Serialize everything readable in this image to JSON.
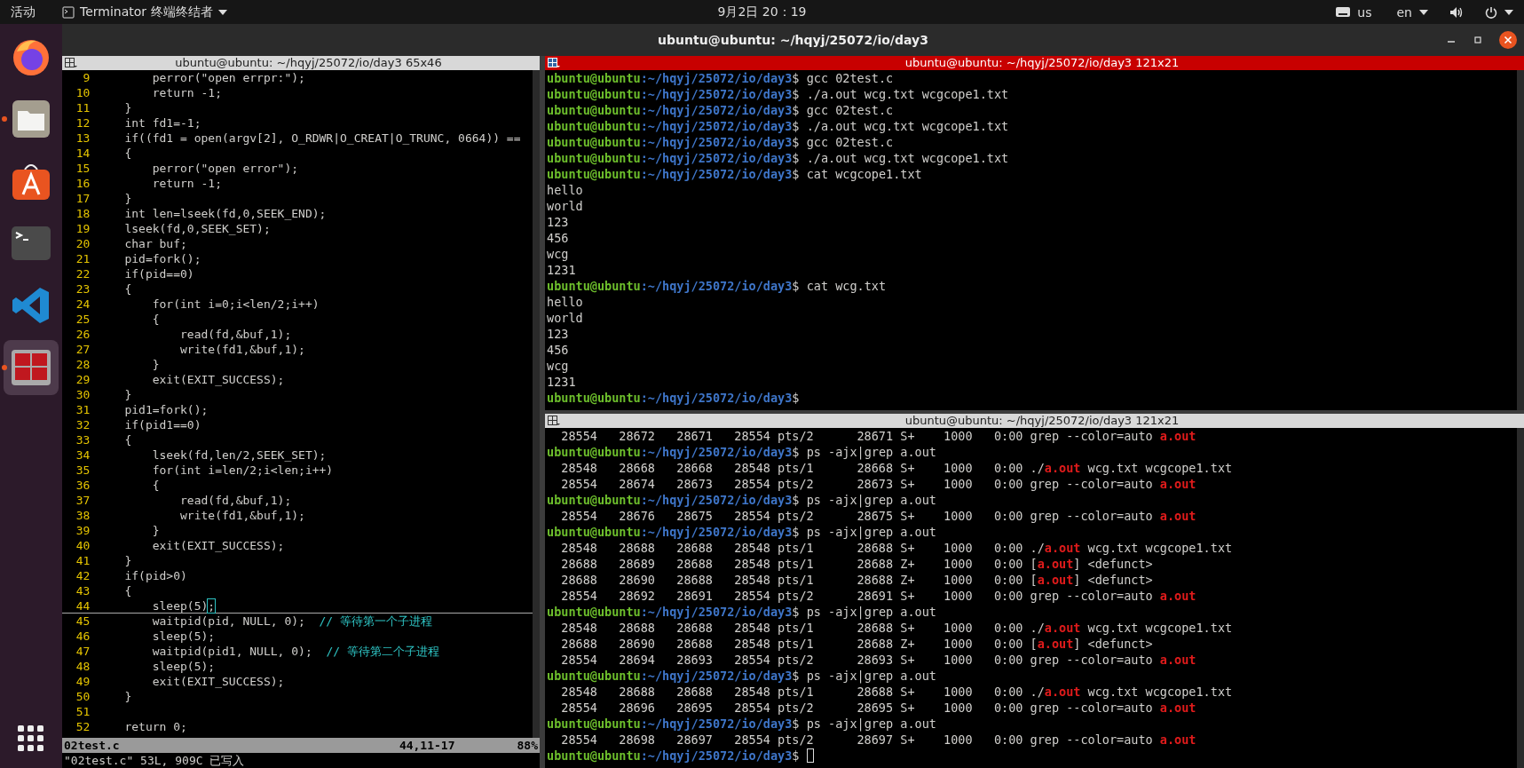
{
  "top_bar": {
    "activities": "活动",
    "app_menu": "Terminator 终端终结者",
    "clock": "9月2日 20：19",
    "keyboard": "us",
    "language": "en"
  },
  "dock": {
    "items": [
      {
        "kind": "firefox",
        "running": false,
        "selected": false
      },
      {
        "kind": "files",
        "running": true,
        "selected": false
      },
      {
        "kind": "store",
        "running": false,
        "selected": false
      },
      {
        "kind": "terminal",
        "running": false,
        "selected": false
      },
      {
        "kind": "vscode",
        "running": false,
        "selected": false
      },
      {
        "kind": "terminator",
        "running": true,
        "selected": true
      }
    ]
  },
  "window": {
    "title": "ubuntu@ubuntu: ~/hqyj/25072/io/day3"
  },
  "editor_pane": {
    "title": "ubuntu@ubuntu: ~/hqyj/25072/io/day3 65x46",
    "focused": false,
    "lines": [
      {
        "num": "9",
        "text": "        perror(\"open errpr:\");"
      },
      {
        "num": "10",
        "text": "        return -1;"
      },
      {
        "num": "11",
        "text": "    }"
      },
      {
        "num": "12",
        "text": "    int fd1=-1;"
      },
      {
        "num": "13",
        "text": "    if((fd1 = open(argv[2], O_RDWR|O_CREAT|O_TRUNC, 0664)) =="
      },
      {
        "num": "14",
        "text": "    {"
      },
      {
        "num": "15",
        "text": "        perror(\"open error\");"
      },
      {
        "num": "16",
        "text": "        return -1;"
      },
      {
        "num": "17",
        "text": "    }"
      },
      {
        "num": "18",
        "text": "    int len=lseek(fd,0,SEEK_END);"
      },
      {
        "num": "19",
        "text": "    lseek(fd,0,SEEK_SET);"
      },
      {
        "num": "20",
        "text": "    char buf;"
      },
      {
        "num": "21",
        "text": "    pid=fork();"
      },
      {
        "num": "22",
        "text": "    if(pid==0)"
      },
      {
        "num": "23",
        "text": "    {"
      },
      {
        "num": "24",
        "text": "        for(int i=0;i<len/2;i++)"
      },
      {
        "num": "25",
        "text": "        {"
      },
      {
        "num": "26",
        "text": "            read(fd,&buf,1);"
      },
      {
        "num": "27",
        "text": "            write(fd1,&buf,1);"
      },
      {
        "num": "28",
        "text": "        }"
      },
      {
        "num": "29",
        "text": "        exit(EXIT_SUCCESS);"
      },
      {
        "num": "30",
        "text": "    }"
      },
      {
        "num": "31",
        "text": "    pid1=fork();"
      },
      {
        "num": "32",
        "text": "    if(pid1==0)"
      },
      {
        "num": "33",
        "text": "    {"
      },
      {
        "num": "34",
        "text": "        lseek(fd,len/2,SEEK_SET);"
      },
      {
        "num": "35",
        "text": "        for(int i=len/2;i<len;i++)"
      },
      {
        "num": "36",
        "text": "        {"
      },
      {
        "num": "37",
        "text": "            read(fd,&buf,1);"
      },
      {
        "num": "38",
        "text": "            write(fd1,&buf,1);"
      },
      {
        "num": "39",
        "text": "        }"
      },
      {
        "num": "40",
        "text": "        exit(EXIT_SUCCESS);"
      },
      {
        "num": "41",
        "text": "    }"
      },
      {
        "num": "42",
        "text": "    if(pid>0)"
      },
      {
        "num": "43",
        "text": "    {"
      },
      {
        "num": "44",
        "text": "        sleep(5)",
        "cursor": ";",
        "current": true
      },
      {
        "num": "45",
        "text": "        waitpid(pid, NULL, 0);  ",
        "comment": "// 等待第一个子进程"
      },
      {
        "num": "46",
        "text": "        sleep(5);"
      },
      {
        "num": "47",
        "text": "        waitpid(pid1, NULL, 0);  ",
        "comment": "// 等待第二个子进程"
      },
      {
        "num": "48",
        "text": "        sleep(5);"
      },
      {
        "num": "49",
        "text": "        exit(EXIT_SUCCESS);"
      },
      {
        "num": "50",
        "text": "    }"
      },
      {
        "num": "51"
      },
      {
        "num": "52",
        "text": "    return 0;"
      }
    ],
    "status": {
      "file": "02test.c",
      "position": "44,11-17",
      "percent": "88%"
    },
    "message": "\"02test.c\" 53L, 909C 已写入"
  },
  "terminal_panes": [
    {
      "title": "ubuntu@ubuntu: ~/hqyj/25072/io/day3 121x21",
      "focused": true,
      "lines": [
        {
          "kind": "prompt",
          "user": "ubuntu@ubuntu",
          "path": ":~/hqyj/25072/io/day3",
          "sign": "$",
          "command": "gcc 02test.c"
        },
        {
          "kind": "prompt",
          "user": "ubuntu@ubuntu",
          "path": ":~/hqyj/25072/io/day3",
          "sign": "$",
          "command": "./a.out wcg.txt wcgcope1.txt"
        },
        {
          "kind": "prompt",
          "user": "ubuntu@ubuntu",
          "path": ":~/hqyj/25072/io/day3",
          "sign": "$",
          "command": "gcc 02test.c"
        },
        {
          "kind": "prompt",
          "user": "ubuntu@ubuntu",
          "path": ":~/hqyj/25072/io/day3",
          "sign": "$",
          "command": "./a.out wcg.txt wcgcope1.txt"
        },
        {
          "kind": "prompt",
          "user": "ubuntu@ubuntu",
          "path": ":~/hqyj/25072/io/day3",
          "sign": "$",
          "command": "gcc 02test.c"
        },
        {
          "kind": "prompt",
          "user": "ubuntu@ubuntu",
          "path": ":~/hqyj/25072/io/day3",
          "sign": "$",
          "command": "./a.out wcg.txt wcgcope1.txt"
        },
        {
          "kind": "prompt",
          "user": "ubuntu@ubuntu",
          "path": ":~/hqyj/25072/io/day3",
          "sign": "$",
          "command": "cat wcgcope1.txt"
        },
        {
          "kind": "output",
          "text": "hello"
        },
        {
          "kind": "output",
          "text": "world"
        },
        {
          "kind": "output",
          "text": "123"
        },
        {
          "kind": "output",
          "text": "456"
        },
        {
          "kind": "output",
          "text": "wcg"
        },
        {
          "kind": "output",
          "text": "1231"
        },
        {
          "kind": "prompt",
          "user": "ubuntu@ubuntu",
          "path": ":~/hqyj/25072/io/day3",
          "sign": "$",
          "command": "cat wcg.txt"
        },
        {
          "kind": "output",
          "text": "hello"
        },
        {
          "kind": "output",
          "text": "world"
        },
        {
          "kind": "output",
          "text": "123"
        },
        {
          "kind": "output",
          "text": "456"
        },
        {
          "kind": "output",
          "text": "wcg"
        },
        {
          "kind": "output",
          "text": "1231"
        },
        {
          "kind": "prompt",
          "user": "ubuntu@ubuntu",
          "path": ":~/hqyj/25072/io/day3",
          "sign": "$"
        }
      ]
    },
    {
      "title": "ubuntu@ubuntu: ~/hqyj/25072/io/day3 121x21",
      "focused": false,
      "lines": [
        {
          "kind": "match",
          "before": "  28554   28672   28671   28554 pts/2      28671 S+    1000   0:00 grep --color=auto ",
          "match": "a.out"
        },
        {
          "kind": "prompt",
          "user": "ubuntu@ubuntu",
          "path": ":~/hqyj/25072/io/day3",
          "sign": "$",
          "command": "ps -ajx|grep a.out"
        },
        {
          "kind": "match",
          "before": "  28548   28668   28668   28548 pts/1      28668 S+    1000   0:00 ./",
          "match": "a.out",
          "after": " wcg.txt wcgcope1.txt"
        },
        {
          "kind": "match",
          "before": "  28554   28674   28673   28554 pts/2      28673 S+    1000   0:00 grep --color=auto ",
          "match": "a.out"
        },
        {
          "kind": "prompt",
          "user": "ubuntu@ubuntu",
          "path": ":~/hqyj/25072/io/day3",
          "sign": "$",
          "command": "ps -ajx|grep a.out"
        },
        {
          "kind": "match",
          "before": "  28554   28676   28675   28554 pts/2      28675 S+    1000   0:00 grep --color=auto ",
          "match": "a.out"
        },
        {
          "kind": "prompt",
          "user": "ubuntu@ubuntu",
          "path": ":~/hqyj/25072/io/day3",
          "sign": "$",
          "command": "ps -ajx|grep a.out"
        },
        {
          "kind": "match",
          "before": "  28548   28688   28688   28548 pts/1      28688 S+    1000   0:00 ./",
          "match": "a.out",
          "after": " wcg.txt wcgcope1.txt"
        },
        {
          "kind": "match",
          "before": "  28688   28689   28688   28548 pts/1      28688 Z+    1000   0:00 [",
          "match": "a.out",
          "after": "] <defunct>"
        },
        {
          "kind": "match",
          "before": "  28688   28690   28688   28548 pts/1      28688 Z+    1000   0:00 [",
          "match": "a.out",
          "after": "] <defunct>"
        },
        {
          "kind": "match",
          "before": "  28554   28692   28691   28554 pts/2      28691 S+    1000   0:00 grep --color=auto ",
          "match": "a.out"
        },
        {
          "kind": "prompt",
          "user": "ubuntu@ubuntu",
          "path": ":~/hqyj/25072/io/day3",
          "sign": "$",
          "command": "ps -ajx|grep a.out"
        },
        {
          "kind": "match",
          "before": "  28548   28688   28688   28548 pts/1      28688 S+    1000   0:00 ./",
          "match": "a.out",
          "after": " wcg.txt wcgcope1.txt"
        },
        {
          "kind": "match",
          "before": "  28688   28690   28688   28548 pts/1      28688 Z+    1000   0:00 [",
          "match": "a.out",
          "after": "] <defunct>"
        },
        {
          "kind": "match",
          "before": "  28554   28694   28693   28554 pts/2      28693 S+    1000   0:00 grep --color=auto ",
          "match": "a.out"
        },
        {
          "kind": "prompt",
          "user": "ubuntu@ubuntu",
          "path": ":~/hqyj/25072/io/day3",
          "sign": "$",
          "command": "ps -ajx|grep a.out"
        },
        {
          "kind": "match",
          "before": "  28548   28688   28688   28548 pts/1      28688 S+    1000   0:00 ./",
          "match": "a.out",
          "after": " wcg.txt wcgcope1.txt"
        },
        {
          "kind": "match",
          "before": "  28554   28696   28695   28554 pts/2      28695 S+    1000   0:00 grep --color=auto ",
          "match": "a.out"
        },
        {
          "kind": "prompt",
          "user": "ubuntu@ubuntu",
          "path": ":~/hqyj/25072/io/day3",
          "sign": "$",
          "command": "ps -ajx|grep a.out"
        },
        {
          "kind": "match",
          "before": "  28554   28698   28697   28554 pts/2      28697 S+    1000   0:00 grep --color=auto ",
          "match": "a.out"
        },
        {
          "kind": "prompt",
          "user": "ubuntu@ubuntu",
          "path": ":~/hqyj/25072/io/day3",
          "sign": "$",
          "cursor": true
        }
      ]
    }
  ]
}
